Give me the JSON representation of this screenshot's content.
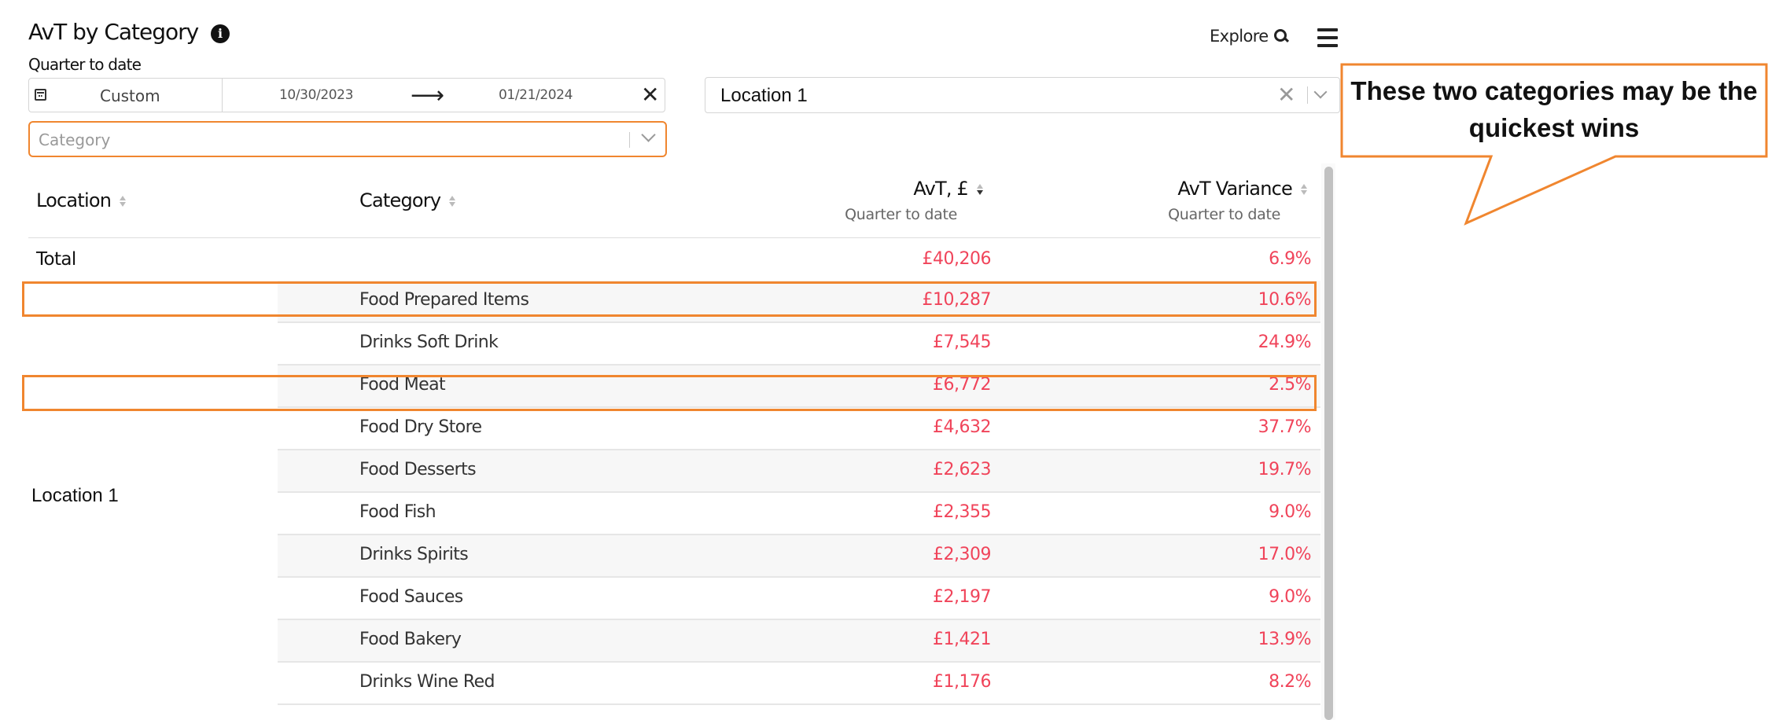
{
  "header": {
    "title": "AvT by Category",
    "subtitle": "Quarter to date",
    "explore_label": "Explore",
    "info_icon": "info-icon",
    "search_icon": "search-icon",
    "menu_icon": "hamburger-menu-icon"
  },
  "filters": {
    "date": {
      "mode": "Custom",
      "start": "10/30/2023",
      "arrow": "⟶",
      "end": "01/21/2024",
      "clear": "✕"
    },
    "location": {
      "value": "Location 1",
      "clear": "✕"
    },
    "category": {
      "placeholder": "Category"
    }
  },
  "table": {
    "columns": {
      "location": "Location",
      "category": "Category",
      "avt": "AvT, £",
      "avt_sub": "Quarter to date",
      "variance": "AvT Variance",
      "variance_sub": "Quarter to date"
    },
    "total": {
      "label": "Total",
      "avt": "£40,206",
      "variance": "6.9%"
    },
    "location_group": "Location 1",
    "rows": [
      {
        "category": "Food Prepared Items",
        "avt": "£10,287",
        "variance": "10.6%"
      },
      {
        "category": "Drinks Soft Drink",
        "avt": "£7,545",
        "variance": "24.9%"
      },
      {
        "category": "Food Meat",
        "avt": "£6,772",
        "variance": "2.5%"
      },
      {
        "category": "Food Dry Store",
        "avt": "£4,632",
        "variance": "37.7%"
      },
      {
        "category": "Food Desserts",
        "avt": "£2,623",
        "variance": "19.7%"
      },
      {
        "category": "Food Fish",
        "avt": "£2,355",
        "variance": "9.0%"
      },
      {
        "category": "Drinks Spirits",
        "avt": "£2,309",
        "variance": "17.0%"
      },
      {
        "category": "Food Sauces",
        "avt": "£2,197",
        "variance": "9.0%"
      },
      {
        "category": "Food Bakery",
        "avt": "£1,421",
        "variance": "13.9%"
      },
      {
        "category": "Drinks Wine Red",
        "avt": "£1,176",
        "variance": "8.2%"
      }
    ]
  },
  "annotation": {
    "callout": "These two categories may be the quickest wins"
  },
  "colors": {
    "negative": "#f0445a",
    "annotation": "#f0862f"
  }
}
